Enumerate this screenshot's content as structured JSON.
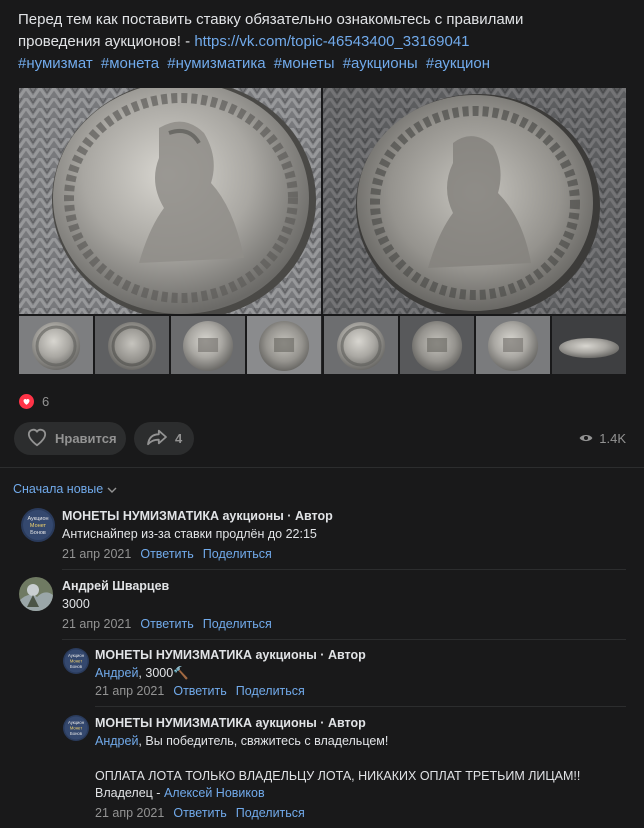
{
  "post": {
    "text_line1": "Перед тем как поставить ставку обязательно ознакомьтесь с правилами",
    "text_line2_prefix": "проведения аукционов! - ",
    "link": "https://vk.com/topic-46543400_33169041",
    "hashtags": [
      "#нумизмат",
      "#монета",
      "#нумизматика",
      "#монеты",
      "#аукционы",
      "#аукцион"
    ]
  },
  "reactions": {
    "likes_count": "6"
  },
  "actions": {
    "like_label": "Нравится",
    "share_count": "4",
    "views": "1.4K"
  },
  "sort_label": "Сначала новые",
  "comments": [
    {
      "author": "МОНЕТЫ НУМИЗМАТИКА аукционы · Автор",
      "text": "Антиснайпер из-за ставки продлён до 22:15",
      "date": "21 апр 2021",
      "reply": "Ответить",
      "share": "Поделиться"
    },
    {
      "author": "Андрей Шварцев",
      "text": "3000",
      "date": "21 апр 2021",
      "reply": "Ответить",
      "share": "Поделиться"
    },
    {
      "author": "МОНЕТЫ НУМИЗМАТИКА аукционы · Автор",
      "mention": "Андрей",
      "text": ", 3000",
      "emoji": "🔨",
      "date": "21 апр 2021",
      "reply": "Ответить",
      "share": "Поделиться"
    },
    {
      "author": "МОНЕТЫ НУМИЗМАТИКА аукционы · Автор",
      "mention": "Андрей",
      "text": ", Вы победитель, свяжитесь с владельцем!",
      "text2": "ОПЛАТА ЛОТА ТОЛЬКО ВЛАДЕЛЬЦУ ЛОТА, НИКАКИХ ОПЛАТ ТРЕТЬИМ ЛИЦАМ!!",
      "owner_prefix": "Владелец - ",
      "owner_link": "Алексей Новиков",
      "date": "21 апр 2021",
      "reply": "Ответить",
      "share": "Поделиться"
    }
  ],
  "avatar_label": {
    "line1": "Аукцион",
    "line2": "Монет",
    "line3": "Бонов"
  },
  "colors": {
    "accent": "#71aaeb",
    "background": "#19191a",
    "like": "#ff3347"
  }
}
